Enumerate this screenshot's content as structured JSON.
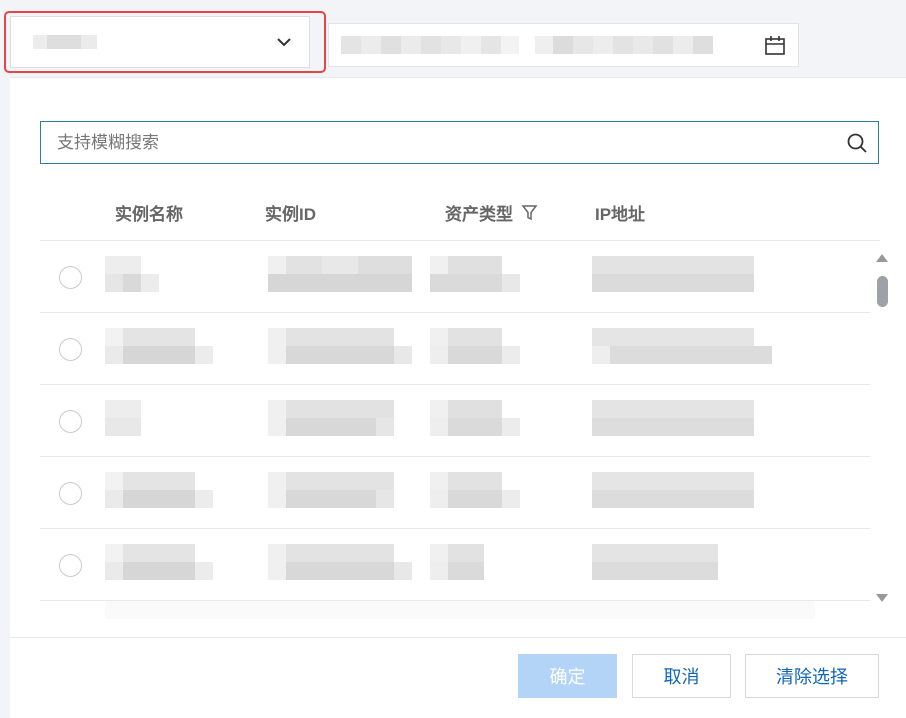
{
  "search": {
    "placeholder": "支持模糊搜索"
  },
  "table": {
    "columns": [
      {
        "label": "实例名称"
      },
      {
        "label": "实例ID"
      },
      {
        "label": "资产类型"
      },
      {
        "label": "IP地址"
      }
    ],
    "row_count": 5,
    "redacted": true
  },
  "footer": {
    "confirm_label": "确定",
    "cancel_label": "取消",
    "clear_label": "清除选择"
  },
  "icons": {
    "chevron": "chevron-down-icon",
    "calendar": "calendar-icon",
    "search": "search-icon",
    "filter": "filter-icon"
  },
  "colors": {
    "highlight": "#e54545",
    "primary_disabled": "#b3d4f7",
    "link": "#1166b5",
    "search_border": "#2e7d9b"
  }
}
